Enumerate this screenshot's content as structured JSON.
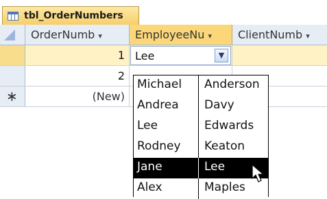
{
  "table_tab": {
    "title": "tbl_OrderNumbers",
    "icon": "table-icon"
  },
  "columns": [
    {
      "label": "OrderNumb",
      "arrow": "▾"
    },
    {
      "label": "EmployeeNu",
      "arrow": "▾"
    },
    {
      "label": "ClientNumb",
      "arrow": "▾"
    }
  ],
  "rows": [
    {
      "order_number": "1",
      "employee": "Lee",
      "client": ""
    },
    {
      "order_number": "2",
      "employee": "",
      "client": ""
    },
    {
      "order_number": "(New)",
      "employee": "",
      "client": "",
      "new_record_symbol": "∗"
    }
  ],
  "combo": {
    "value": "Lee",
    "button_icon": "chevron-down-icon"
  },
  "dropdown": {
    "items": [
      {
        "first": "Michael",
        "last": "Anderson"
      },
      {
        "first": "Andrea",
        "last": "Davy"
      },
      {
        "first": "Lee",
        "last": "Edwards"
      },
      {
        "first": "Rodney",
        "last": "Keaton"
      },
      {
        "first": "Jane",
        "last": "Lee",
        "selected": true
      },
      {
        "first": "Alex",
        "last": "Maples"
      }
    ]
  },
  "colors": {
    "tab_gold": "#f6cf6b",
    "header_active": "#fbd77a",
    "row_active": "#fff2c4",
    "grid_header": "#e7edf5",
    "selection": "#000000"
  }
}
